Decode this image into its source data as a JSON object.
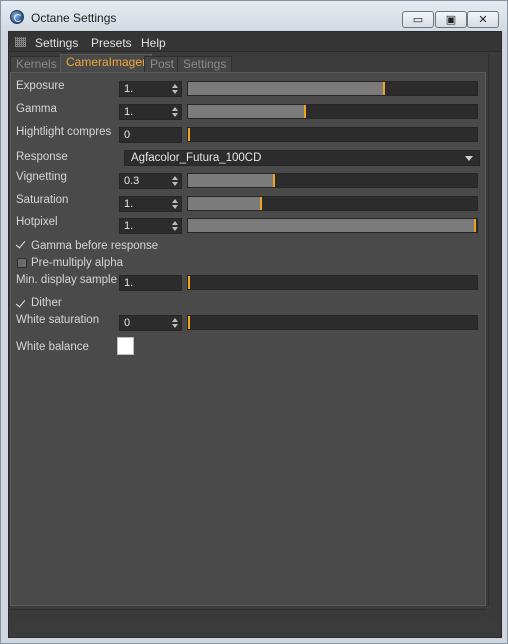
{
  "window": {
    "title": "Octane Settings",
    "min_glyph": "▭",
    "max_glyph": "▣",
    "close_glyph": "✕"
  },
  "menu": {
    "items": [
      "Settings",
      "Presets",
      "Help"
    ]
  },
  "tabs": [
    {
      "label": "Kernels",
      "active": false
    },
    {
      "label": "CameraImager",
      "active": true
    },
    {
      "label": "Post",
      "active": false
    },
    {
      "label": "Settings",
      "active": false
    }
  ],
  "fields": {
    "exposure": {
      "label": "Exposure",
      "value": "1.",
      "slider_fraction": 0.68
    },
    "gamma": {
      "label": "Gamma",
      "value": "1.",
      "slider_fraction": 0.405
    },
    "highlight": {
      "label": "Hightlight compres",
      "value": "0",
      "slider_fraction": 0.0
    },
    "response": {
      "label": "Response",
      "value": "Agfacolor_Futura_100CD"
    },
    "vignetting": {
      "label": "Vignetting",
      "value": "0.3",
      "slider_fraction": 0.295
    },
    "saturation": {
      "label": "Saturation",
      "value": "1.",
      "slider_fraction": 0.25
    },
    "hotpixel": {
      "label": "Hotpixel",
      "value": "1.",
      "slider_fraction": 0.995
    },
    "gamma_before_response": {
      "label": "Gamma before response",
      "checked": true
    },
    "premultiply_alpha": {
      "label": "Pre-multiply alpha",
      "checked": false
    },
    "min_display_samples": {
      "label": "Min. display sample",
      "value": "1.",
      "slider_fraction": 0.0
    },
    "dither": {
      "label": "Dither",
      "checked": true
    },
    "white_saturation": {
      "label": "White saturation",
      "value": "0",
      "slider_fraction": 0.0
    },
    "white_balance": {
      "label": "White balance",
      "color": "#ffffff"
    }
  },
  "colors": {
    "accent": "#f0a73a",
    "knob": "#f3a31c",
    "panel": "#4a4a4a"
  }
}
